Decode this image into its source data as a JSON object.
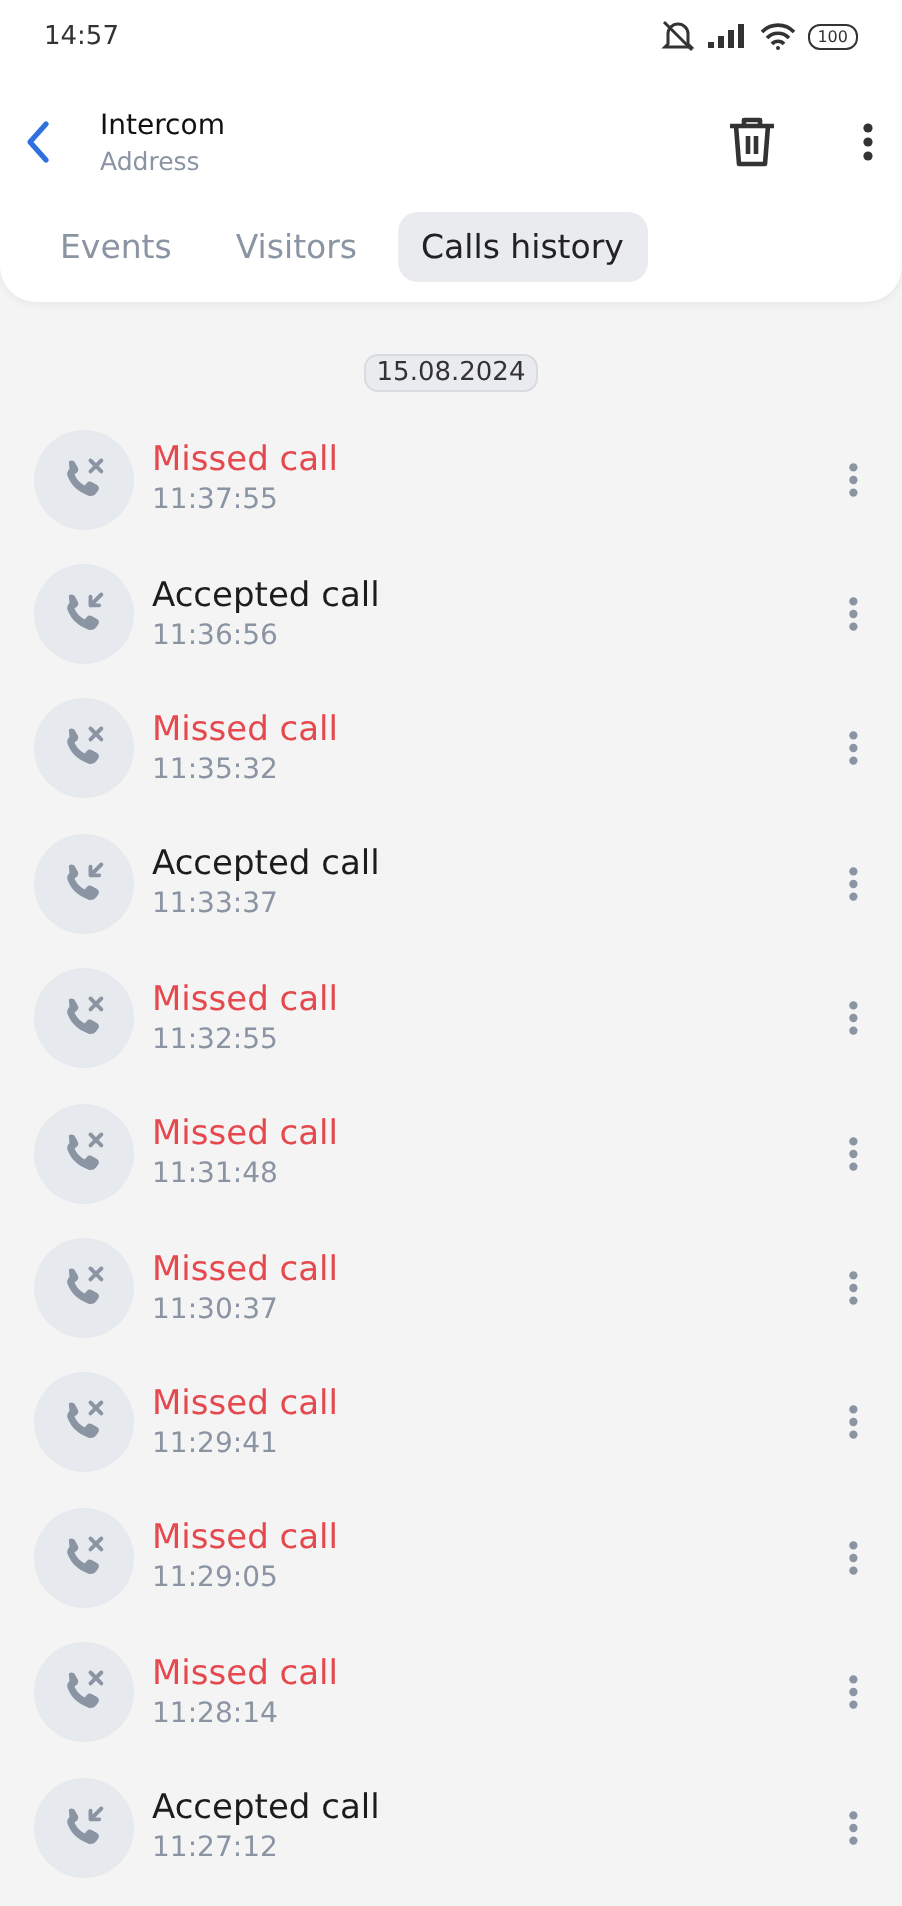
{
  "status_bar": {
    "time": "14:57",
    "battery": "100"
  },
  "header": {
    "title": "Intercom",
    "subtitle": "Address"
  },
  "tabs": [
    {
      "label": "Events",
      "selected": false
    },
    {
      "label": "Visitors",
      "selected": false
    },
    {
      "label": "Calls history",
      "selected": true
    }
  ],
  "date": "15.08.2024",
  "calls": [
    {
      "kind": "missed",
      "label": "Missed call",
      "time": "11:37:55"
    },
    {
      "kind": "accepted",
      "label": "Accepted call",
      "time": "11:36:56"
    },
    {
      "kind": "missed",
      "label": "Missed call",
      "time": "11:35:32"
    },
    {
      "kind": "accepted",
      "label": "Accepted call",
      "time": "11:33:37"
    },
    {
      "kind": "missed",
      "label": "Missed call",
      "time": "11:32:55"
    },
    {
      "kind": "missed",
      "label": "Missed call",
      "time": "11:31:48"
    },
    {
      "kind": "missed",
      "label": "Missed call",
      "time": "11:30:37"
    },
    {
      "kind": "missed",
      "label": "Missed call",
      "time": "11:29:41"
    },
    {
      "kind": "missed",
      "label": "Missed call",
      "time": "11:29:05"
    },
    {
      "kind": "missed",
      "label": "Missed call",
      "time": "11:28:14"
    },
    {
      "kind": "accepted",
      "label": "Accepted call",
      "time": "11:27:12"
    }
  ]
}
